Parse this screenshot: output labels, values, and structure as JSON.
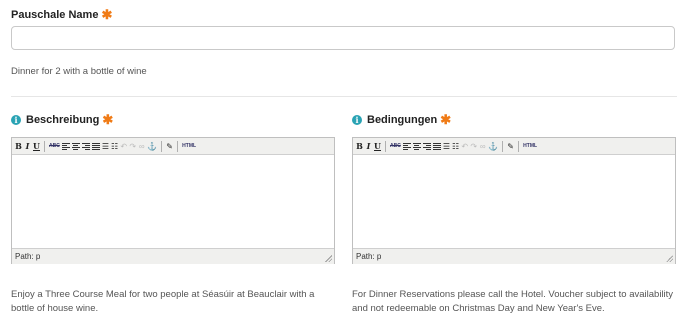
{
  "package_name": {
    "label": "Pauschale Name",
    "required_mark": "✱",
    "value": "",
    "help": "Dinner for 2 with a bottle of wine"
  },
  "toolbar": {
    "bold": "B",
    "italic": "I",
    "underline": "U",
    "strike": "ABC",
    "html": "HTML",
    "icons": [
      "bold-icon",
      "italic-icon",
      "underline-icon",
      "strikethrough-icon",
      "align-left-icon",
      "align-center-icon",
      "align-right-icon",
      "align-justify-icon",
      "bullet-list-icon",
      "numbered-list-icon",
      "undo-icon",
      "redo-icon",
      "link-icon",
      "anchor-icon",
      "cleanup-icon",
      "html-icon"
    ]
  },
  "description": {
    "label": "Beschreibung",
    "required_mark": "✱",
    "path": "Path: p",
    "help": "Enjoy a Three Course Meal for two people at Séasúir at Beauclair with a bottle of house wine."
  },
  "conditions": {
    "label": "Bedingungen",
    "required_mark": "✱",
    "path": "Path: p",
    "help": "For Dinner Reservations please call the Hotel. Voucher subject to availability and not redeemable on Christmas Day and New Year's Eve."
  },
  "colors": {
    "required": "#f07b16",
    "info": "#2aa3b4"
  }
}
